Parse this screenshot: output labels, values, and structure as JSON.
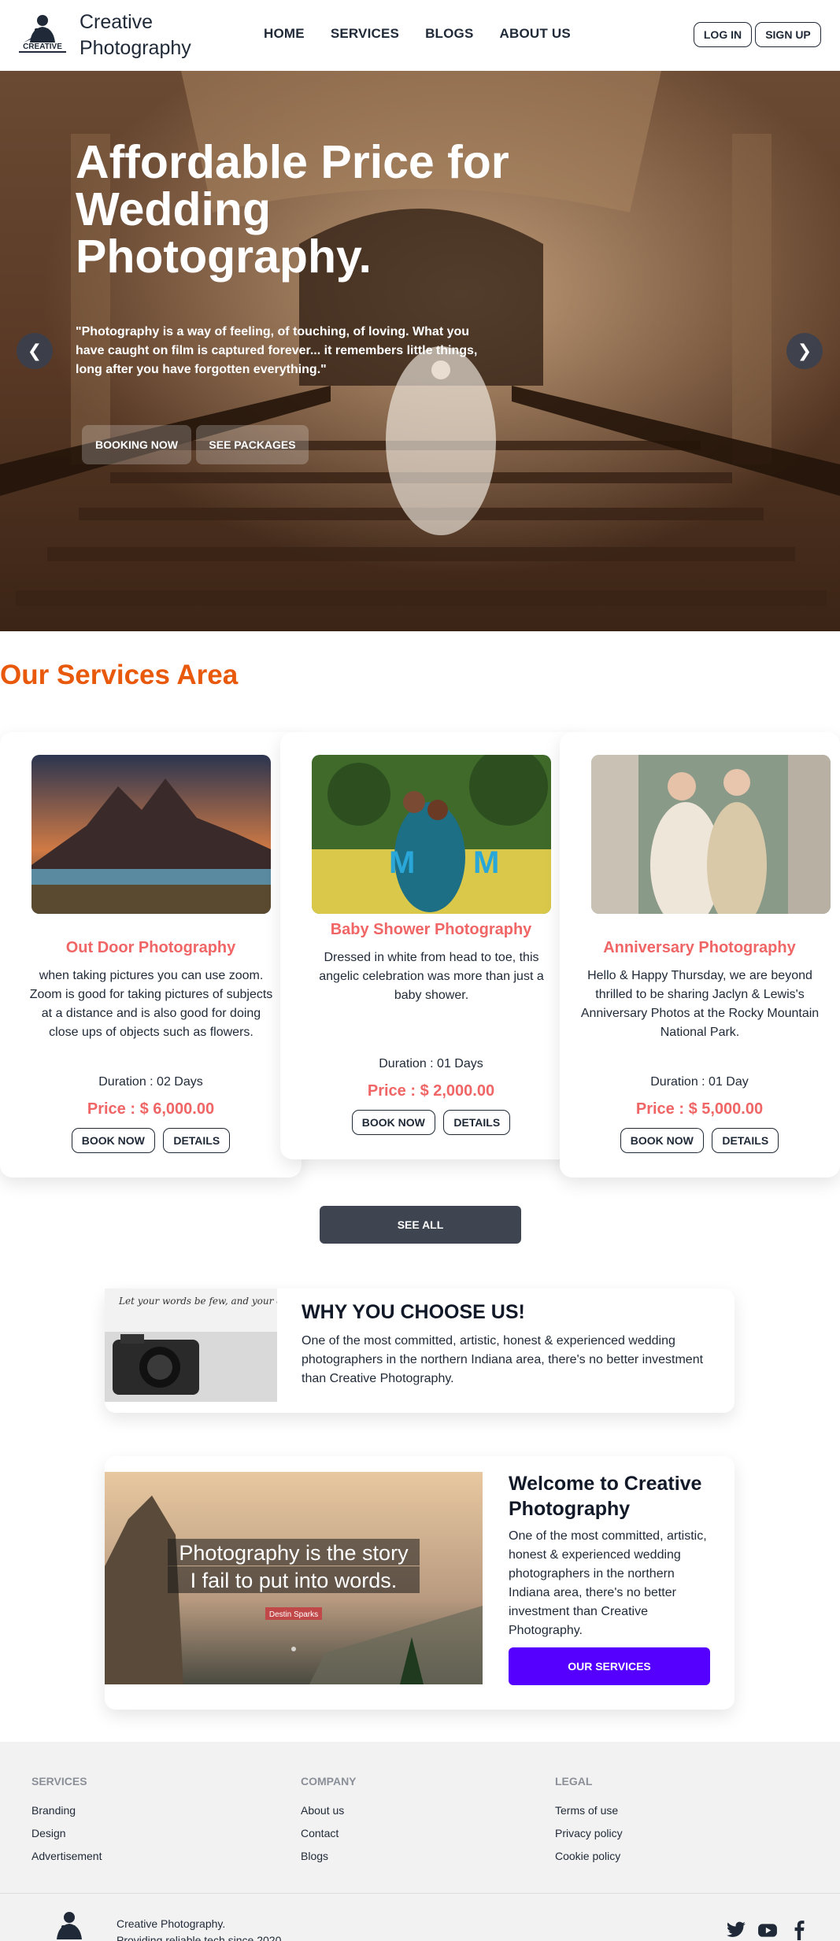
{
  "nav": {
    "logo_text": "CREATIVE",
    "brand": "Creative Photography",
    "menu": [
      "HOME",
      "SERVICES",
      "BLOGS",
      "ABOUT US"
    ],
    "login": "LOG IN",
    "signup": "SIGN UP"
  },
  "hero": {
    "title": "Affordable Price for Wedding Photography.",
    "quote": "\"Photography is a way of feeling, of touching, of loving. What you have caught on film is captured forever... it remembers little things, long after you have forgotten everything.\"",
    "booking": "BOOKING NOW",
    "packages": "SEE PACKAGES",
    "prev": "❮",
    "next": "❯"
  },
  "services": {
    "title": "Our Services Area",
    "cards": [
      {
        "title": "Out Door Photography",
        "desc": "when taking pictures you can use zoom. Zoom is good for taking pictures of subjects at a distance and is also good for doing close ups of objects such as flowers.",
        "duration": "Duration : 02 Days",
        "price": "Price : $ 6,000.00",
        "book": "BOOK NOW",
        "details": "DETAILS"
      },
      {
        "title": "Baby Shower Photography",
        "desc": "Dressed in white from head to toe, this angelic celebration was more than just a baby shower.",
        "duration": "Duration : 01 Days",
        "price": "Price : $ 2,000.00",
        "book": "BOOK NOW",
        "details": "DETAILS"
      },
      {
        "title": "Anniversary Photography",
        "desc": "Hello & Happy Thursday, we are beyond thrilled to be sharing Jaclyn & Lewis's Anniversary Photos at the Rocky Mountain National Park.",
        "duration": "Duration : 01 Day",
        "price": "Price : $ 5,000.00",
        "book": "BOOK NOW",
        "details": "DETAILS"
      }
    ],
    "see_all": "SEE ALL"
  },
  "why": {
    "title": "WHY YOU CHOOSE US!",
    "text": "One of the most committed, artistic, honest & experienced wedding photographers in the northern Indiana area, there's no better investment than Creative Photography.",
    "img_text": "Let your words be few, and your exposures many."
  },
  "welcome": {
    "title": "Welcome to Creative Photography",
    "text": "One of the most committed, artistic, honest & experienced wedding photographers in the northern Indiana area, there's no better investment than Creative Photography.",
    "button": "OUR SERVICES",
    "img_quote_1": "Photography is the story",
    "img_quote_2": "I fail to put into words.",
    "img_author": "Destin Sparks"
  },
  "footer": {
    "columns": [
      {
        "head": "SERVICES",
        "links": [
          "Branding",
          "Design",
          "Advertisement"
        ]
      },
      {
        "head": "COMPANY",
        "links": [
          "About us",
          "Contact",
          "Blogs"
        ]
      },
      {
        "head": "LEGAL",
        "links": [
          "Terms of use",
          "Privacy policy",
          "Cookie policy"
        ]
      }
    ],
    "brand_line1": "Creative Photography.",
    "brand_line2": "Providing reliable tech since 2020",
    "social": [
      "twitter-icon",
      "youtube-icon",
      "facebook-icon"
    ]
  },
  "colors": {
    "accent_orange": "#e8590c",
    "card_red": "#f06565",
    "primary_purple": "#5500ff",
    "dark_button": "#3f4451"
  }
}
